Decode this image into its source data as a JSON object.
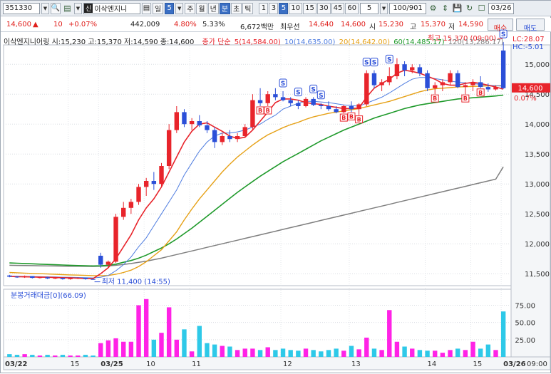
{
  "toolbar": {
    "code": "351330",
    "stock_name": "이삭엔지니",
    "period_day": "일",
    "period_num": "5",
    "periods": [
      "주",
      "월",
      "년",
      "분",
      "초",
      "틱"
    ],
    "active_period": "분",
    "intervals": [
      "1",
      "3",
      "5",
      "10",
      "15",
      "30",
      "45",
      "60"
    ],
    "active_interval": "5",
    "count_select": "5",
    "paging": "100/901",
    "date": "03/26"
  },
  "quote": {
    "price": "14,600",
    "arrow": "▲",
    "change": "10",
    "change_pct": "+0.07%",
    "volume": "442,009",
    "vol_ratio": "4.80%",
    "turnover_ratio": "5.33%",
    "amount": "6,672백만",
    "best_label": "최우선",
    "best_ask": "14,640",
    "best_bid": "14,600",
    "open_label": "시",
    "open": "15,230",
    "high_label": "고",
    "high": "15,370",
    "low_label": "저",
    "low": "14,590",
    "buy_button": "매수",
    "sell_button": "매도"
  },
  "legend": {
    "main": "이삭엔지니어링 시:15,230 고:15,370 저:14,590 종:14,600",
    "close_type": "종가 단순",
    "ma5": "5(14,584.00)",
    "ma10": "10(14,635.00)",
    "ma20": "20(14,642.00)",
    "ma60": "60(14,485.17)",
    "ma120": "120(13,286.17)",
    "lc": "LC:28.07",
    "hc": "HC:-5.01"
  },
  "annotations": {
    "high_note": "최고 15,370 (09:00)",
    "low_note": "최저 11,400 (14:55)",
    "current_price": "14,600",
    "current_pct": "0.07%",
    "volume_title": "분봉거래대금[0](66.09)"
  },
  "colors": {
    "up": "#e8242b",
    "down": "#2b4fd8",
    "ma5": "#e8242b",
    "ma10": "#4f7de0",
    "ma20": "#e6a117",
    "ma60": "#1f9a2b",
    "ma120": "#7f7f7f",
    "vol_up": "#ff22e6",
    "vol_down": "#2ec9e8"
  },
  "chart_data": {
    "type": "candlestick",
    "price_axis_ticks": [
      15000,
      14500,
      14000,
      13500,
      13000,
      12500,
      12000,
      11500
    ],
    "price_range": [
      11300,
      15300
    ],
    "volume_axis_ticks": [
      75,
      50,
      25
    ],
    "volume_range": [
      0,
      90
    ],
    "x_labels": [
      "03/22",
      "15",
      "03/25",
      "10",
      "11",
      "12",
      "13",
      "14",
      "15",
      "03/26",
      "09:00"
    ],
    "ma_labels": [
      "5",
      "10",
      "20",
      "60",
      "120"
    ],
    "ohlc": [
      [
        11470,
        11480,
        11440,
        11450
      ],
      [
        11450,
        11460,
        11430,
        11440
      ],
      [
        11440,
        11470,
        11430,
        11460
      ],
      [
        11460,
        11460,
        11420,
        11430
      ],
      [
        11430,
        11450,
        11420,
        11440
      ],
      [
        11440,
        11450,
        11410,
        11420
      ],
      [
        11420,
        11440,
        11410,
        11430
      ],
      [
        11430,
        11430,
        11400,
        11410
      ],
      [
        11410,
        11430,
        11400,
        11420
      ],
      [
        11420,
        11440,
        11410,
        11430
      ],
      [
        11430,
        11430,
        11400,
        11410
      ],
      [
        11410,
        11420,
        11400,
        11400
      ],
      [
        11800,
        11850,
        11600,
        11650
      ],
      [
        11650,
        11720,
        11600,
        11700
      ],
      [
        11700,
        12500,
        11680,
        12450
      ],
      [
        12450,
        12700,
        12400,
        12600
      ],
      [
        12600,
        12750,
        12500,
        12700
      ],
      [
        12700,
        13000,
        12650,
        12950
      ],
      [
        12950,
        13100,
        12800,
        13050
      ],
      [
        13050,
        13200,
        12900,
        13000
      ],
      [
        13000,
        13350,
        12950,
        13300
      ],
      [
        13300,
        14000,
        13250,
        13900
      ],
      [
        13900,
        14300,
        13850,
        14200
      ],
      [
        14200,
        14250,
        13950,
        14000
      ],
      [
        14000,
        14100,
        13900,
        14050
      ],
      [
        14050,
        14150,
        13950,
        13980
      ],
      [
        13980,
        14050,
        13850,
        13900
      ],
      [
        13900,
        13950,
        13600,
        13700
      ],
      [
        13700,
        13850,
        13650,
        13800
      ],
      [
        13800,
        13900,
        13700,
        13750
      ],
      [
        13750,
        13850,
        13700,
        13800
      ],
      [
        13800,
        14000,
        13780,
        13950
      ],
      [
        13950,
        14500,
        13900,
        14400
      ],
      [
        14400,
        14600,
        14300,
        14350
      ],
      [
        14350,
        14550,
        14300,
        14500
      ],
      [
        14500,
        14600,
        14400,
        14450
      ],
      [
        14450,
        14550,
        14380,
        14400
      ],
      [
        14400,
        14450,
        14300,
        14350
      ],
      [
        14350,
        14400,
        14250,
        14300
      ],
      [
        14300,
        14450,
        14280,
        14420
      ],
      [
        14420,
        14450,
        14300,
        14320
      ],
      [
        14320,
        14350,
        14250,
        14300
      ],
      [
        14300,
        14380,
        14220,
        14250
      ],
      [
        14250,
        14300,
        14180,
        14200
      ],
      [
        14200,
        14320,
        14180,
        14300
      ],
      [
        14300,
        14380,
        14200,
        14250
      ],
      [
        14250,
        14350,
        14150,
        14330
      ],
      [
        14330,
        14900,
        14300,
        14850
      ],
      [
        14850,
        14900,
        14600,
        14650
      ],
      [
        14650,
        14750,
        14550,
        14700
      ],
      [
        14700,
        14950,
        14650,
        14800
      ],
      [
        14800,
        15100,
        14750,
        15000
      ],
      [
        15000,
        15050,
        14800,
        14900
      ],
      [
        14900,
        15000,
        14850,
        14950
      ],
      [
        14950,
        15000,
        14800,
        14850
      ],
      [
        14850,
        14900,
        14550,
        14600
      ],
      [
        14600,
        14700,
        14500,
        14650
      ],
      [
        14650,
        14750,
        14550,
        14700
      ],
      [
        14700,
        14900,
        14650,
        14850
      ],
      [
        14850,
        14900,
        14600,
        14620
      ],
      [
        14620,
        14700,
        14500,
        14650
      ],
      [
        14650,
        14750,
        14550,
        14700
      ],
      [
        14700,
        14800,
        14600,
        14620
      ],
      [
        14620,
        14680,
        14540,
        14580
      ],
      [
        14580,
        14650,
        14560,
        14620
      ],
      [
        15230,
        15370,
        14590,
        14600
      ]
    ],
    "ma5": [
      11455,
      11450,
      11448,
      11445,
      11442,
      11440,
      11436,
      11432,
      11430,
      11425,
      11420,
      11418,
      11500,
      11600,
      11750,
      11950,
      12150,
      12400,
      12600,
      12750,
      12950,
      13200,
      13450,
      13700,
      13880,
      14000,
      14020,
      13950,
      13880,
      13800,
      13760,
      13780,
      13900,
      14050,
      14200,
      14360,
      14420,
      14420,
      14400,
      14360,
      14340,
      14330,
      14300,
      14280,
      14260,
      14260,
      14270,
      14450,
      14600,
      14680,
      14750,
      14850,
      14900,
      14880,
      14850,
      14800,
      14750,
      14680,
      14650,
      14650,
      14680,
      14700,
      14680,
      14650,
      14620,
      14584
    ],
    "ma10": [
      11460,
      11458,
      11455,
      11452,
      11450,
      11448,
      11445,
      11442,
      11440,
      11437,
      11433,
      11430,
      11440,
      11470,
      11550,
      11650,
      11780,
      11950,
      12100,
      12300,
      12500,
      12700,
      12900,
      13150,
      13350,
      13550,
      13700,
      13800,
      13850,
      13850,
      13870,
      13900,
      13950,
      14000,
      14080,
      14150,
      14250,
      14300,
      14350,
      14380,
      14380,
      14370,
      14360,
      14340,
      14320,
      14310,
      14300,
      14350,
      14400,
      14450,
      14520,
      14600,
      14680,
      14750,
      14780,
      14780,
      14760,
      14740,
      14720,
      14700,
      14690,
      14680,
      14660,
      14650,
      14640,
      14635
    ],
    "ma20": [
      11520,
      11515,
      11510,
      11505,
      11500,
      11495,
      11490,
      11485,
      11480,
      11476,
      11472,
      11468,
      11465,
      11470,
      11490,
      11520,
      11560,
      11620,
      11700,
      11800,
      11900,
      12050,
      12200,
      12400,
      12580,
      12750,
      12900,
      13050,
      13200,
      13330,
      13450,
      13550,
      13650,
      13740,
      13820,
      13880,
      13940,
      13990,
      14030,
      14080,
      14120,
      14150,
      14180,
      14200,
      14220,
      14240,
      14260,
      14290,
      14320,
      14350,
      14380,
      14420,
      14460,
      14500,
      14540,
      14570,
      14590,
      14600,
      14610,
      14620,
      14625,
      14630,
      14635,
      14638,
      14640,
      14642
    ],
    "ma60": [
      11680,
      11675,
      11670,
      11665,
      11660,
      11655,
      11650,
      11645,
      11640,
      11636,
      11632,
      11630,
      11632,
      11640,
      11660,
      11690,
      11720,
      11760,
      11810,
      11870,
      11930,
      12000,
      12080,
      12170,
      12260,
      12360,
      12460,
      12560,
      12660,
      12760,
      12860,
      12950,
      13040,
      13130,
      13210,
      13290,
      13370,
      13440,
      13510,
      13580,
      13650,
      13720,
      13780,
      13840,
      13900,
      13950,
      14000,
      14050,
      14100,
      14140,
      14180,
      14220,
      14260,
      14290,
      14320,
      14340,
      14360,
      14380,
      14400,
      14420,
      14430,
      14440,
      14450,
      14460,
      14470,
      14485
    ],
    "ma120": [
      11640,
      11638,
      11636,
      11634,
      11632,
      11630,
      11628,
      11626,
      11625,
      11624,
      11623,
      11622,
      11624,
      11630,
      11640,
      11655,
      11670,
      11690,
      11710,
      11735,
      11760,
      11790,
      11820,
      11850,
      11880,
      11910,
      11940,
      11970,
      12000,
      12030,
      12060,
      12090,
      12120,
      12150,
      12180,
      12210,
      12240,
      12270,
      12300,
      12330,
      12360,
      12390,
      12420,
      12450,
      12480,
      12510,
      12540,
      12570,
      12600,
      12630,
      12660,
      12690,
      12720,
      12750,
      12780,
      12810,
      12840,
      12870,
      12900,
      12930,
      12960,
      12990,
      13020,
      13050,
      13080,
      13286
    ],
    "volume": [
      4,
      3,
      4,
      3,
      2,
      3,
      2,
      3,
      2,
      2,
      3,
      2,
      20,
      24,
      27,
      22,
      22,
      75,
      84,
      25,
      35,
      72,
      25,
      40,
      8,
      45,
      20,
      18,
      16,
      15,
      10,
      12,
      12,
      10,
      14,
      10,
      12,
      10,
      9,
      12,
      10,
      8,
      10,
      12,
      9,
      16,
      11,
      28,
      12,
      10,
      68,
      22,
      15,
      12,
      10,
      9,
      9,
      6,
      10,
      12,
      10,
      22,
      12,
      18,
      10,
      66
    ],
    "volume_up": [
      false,
      false,
      true,
      false,
      true,
      false,
      true,
      false,
      true,
      true,
      false,
      false,
      true,
      true,
      true,
      true,
      true,
      true,
      true,
      false,
      true,
      true,
      true,
      false,
      true,
      false,
      false,
      false,
      true,
      false,
      true,
      true,
      true,
      false,
      true,
      false,
      false,
      false,
      false,
      true,
      false,
      false,
      false,
      false,
      true,
      false,
      true,
      true,
      false,
      true,
      true,
      true,
      false,
      true,
      false,
      false,
      true,
      true,
      true,
      false,
      true,
      true,
      false,
      false,
      true,
      false
    ],
    "signals_s_index": [
      36,
      38,
      40,
      41,
      47,
      48,
      50,
      65
    ],
    "signals_b_index": [
      33,
      34,
      44,
      45,
      46,
      56,
      60,
      62
    ]
  }
}
